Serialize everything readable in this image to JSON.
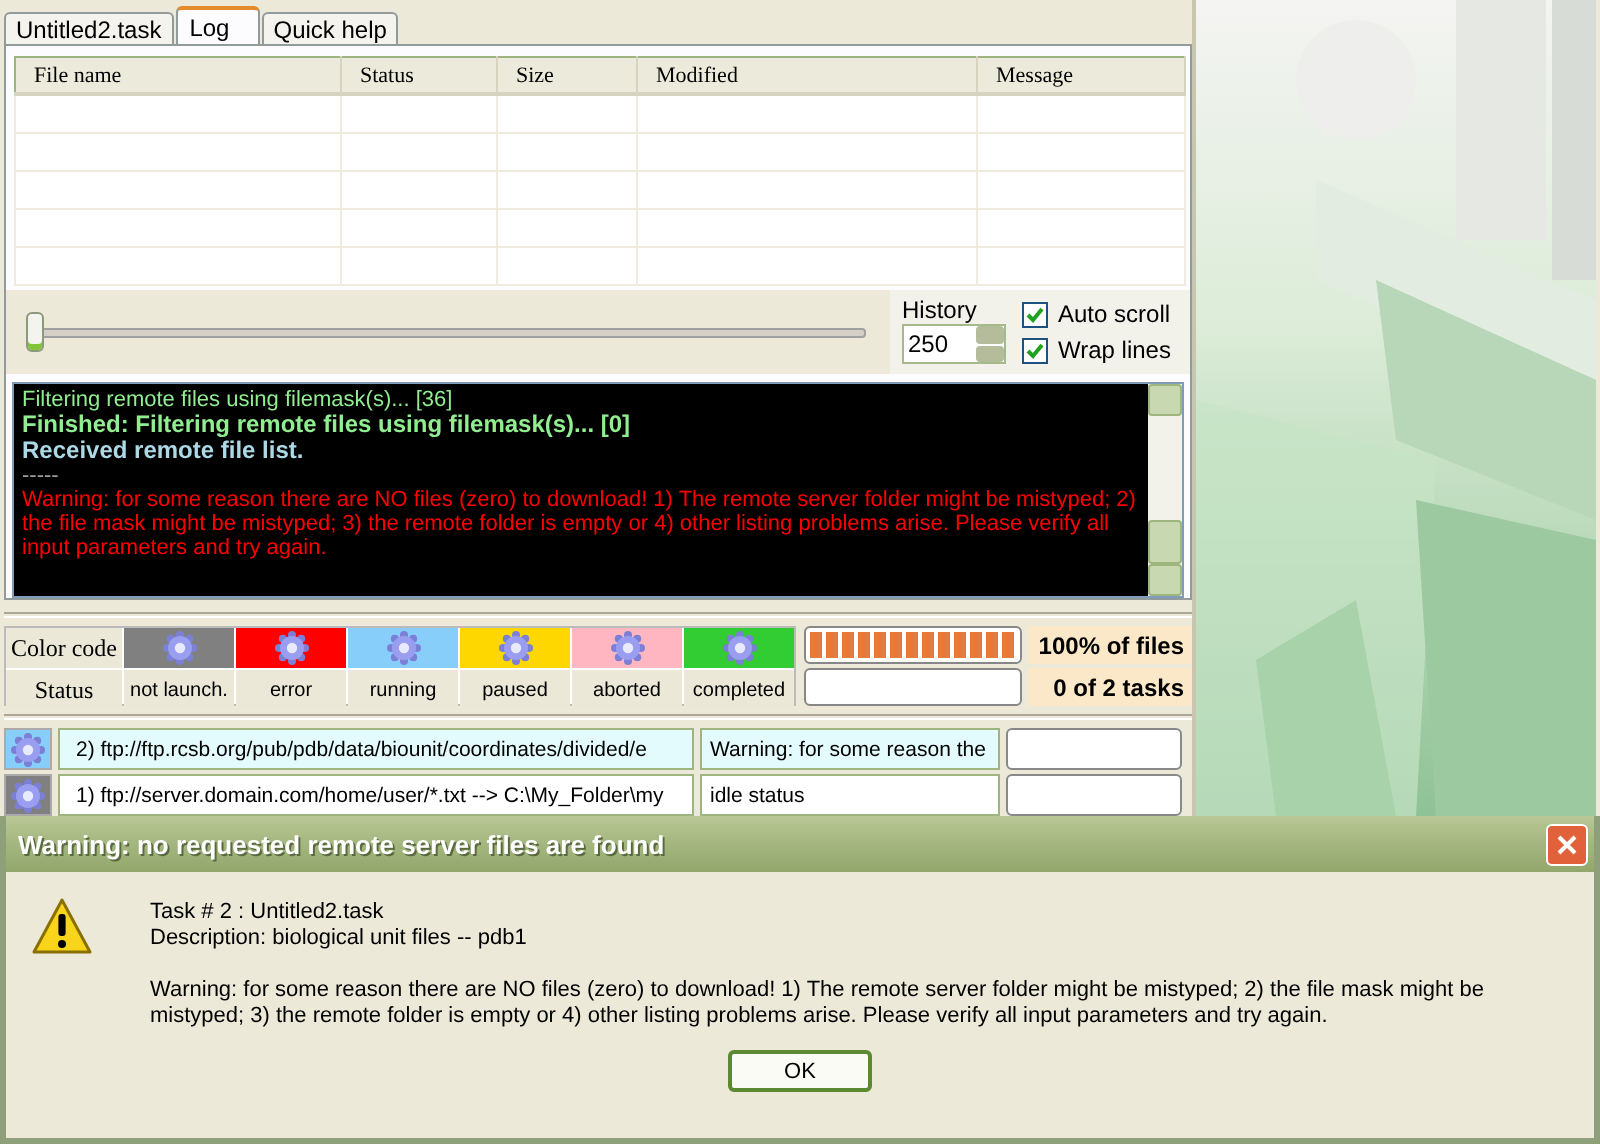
{
  "tabs": [
    {
      "label": "Untitled2.task",
      "selected": false
    },
    {
      "label": "Log",
      "selected": true
    },
    {
      "label": "Quick help",
      "selected": false
    }
  ],
  "file_table": {
    "columns": [
      "File name",
      "Status",
      "Size",
      "Modified",
      "Message"
    ]
  },
  "slider": {
    "level": 0
  },
  "history": {
    "label": "History",
    "value": "250"
  },
  "options": [
    {
      "label": "Auto scroll",
      "checked": true
    },
    {
      "label": "Wrap lines",
      "checked": true
    }
  ],
  "log": [
    {
      "kind": "info",
      "text": "Filtering remote files using filemask(s)... [36]"
    },
    {
      "kind": "done",
      "text": "Finished: Filtering remote files using filemask(s)... [0]"
    },
    {
      "kind": "received",
      "text": "Received remote file list."
    },
    {
      "kind": "separator",
      "text": "-----"
    },
    {
      "kind": "warning",
      "text": "Warning: for some reason there are NO files (zero) to download! 1) The remote server folder might be mistyped; 2) the file mask might be mistyped; 3) the remote folder is empty or 4) other listing problems arise. Please verify all input parameters and try again."
    }
  ],
  "legend": {
    "row_labels": [
      "Color code",
      "Status"
    ],
    "statuses": [
      {
        "label": "not launch.",
        "color": "#808080"
      },
      {
        "label": "error",
        "color": "#ff0000"
      },
      {
        "label": "running",
        "color": "#87cefa"
      },
      {
        "label": "paused",
        "color": "#ffd700"
      },
      {
        "label": "aborted",
        "color": "#ffb6c1"
      },
      {
        "label": "completed",
        "color": "#32cd32"
      }
    ]
  },
  "progress": [
    {
      "level": 1,
      "reading": "100% of files"
    },
    {
      "level": 0,
      "reading": "0 of 2 tasks"
    }
  ],
  "tasks": [
    {
      "color": "#87cefa",
      "url": "2)  ftp://ftp.rcsb.org/pub/pdb/data/biounit/coordinates/divided/e",
      "message": "Warning: for some reason the",
      "level": 0
    },
    {
      "color": "#808080",
      "url": "1)  ftp://server.domain.com/home/user/*.txt --> C:\\My_Folder\\my",
      "message": "idle status",
      "level": 0
    }
  ],
  "dialog": {
    "title": "Warning: no requested remote server files are found",
    "lines": [
      "Task # 2 : Untitled2.task",
      "Description: biological unit files -- pdb1"
    ],
    "message": "Warning: for some reason there are NO files (zero) to download! 1) The remote server folder might be mistyped; 2) the file mask might be mistyped; 3) the remote folder is empty or 4) other listing problems arise. Please verify all input parameters and try again.",
    "button": "OK"
  }
}
